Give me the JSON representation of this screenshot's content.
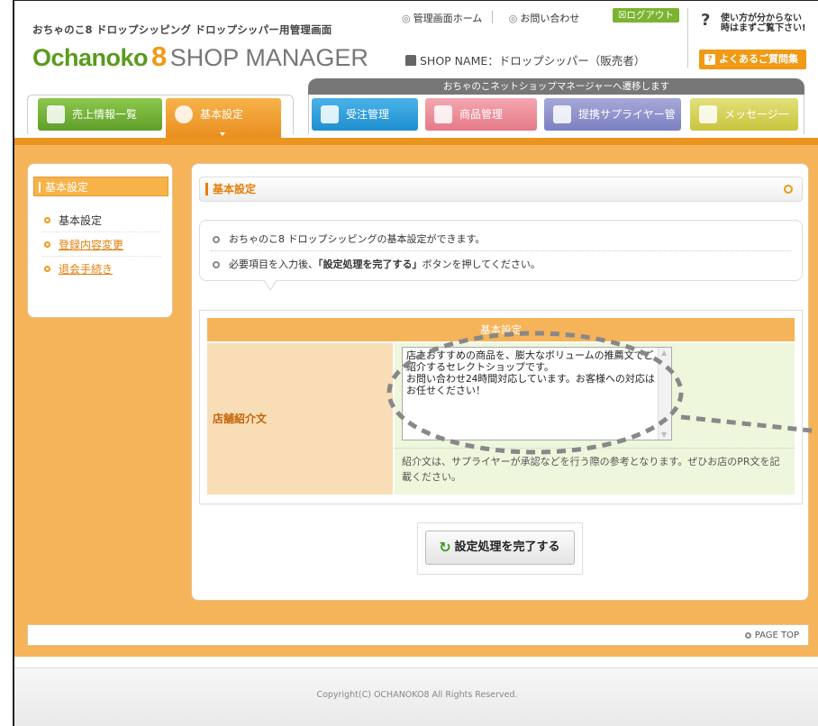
{
  "header": {
    "sub_title": "おちゃのこ8 ドロップシッピング ドロップシッパー用管理画面",
    "logo_main": "Ochanoko",
    "logo_eight": "8",
    "logo_sub": "SHOP MANAGER",
    "link_home": "管理画面ホーム",
    "link_contact": "お問い合わせ",
    "logout": "ログアウト",
    "shop_name": "SHOP NAME：ドロップシッパー（販売者）",
    "help_line1": "使い方が分からない",
    "help_line2": "時はまずご覧下さい!",
    "faq": "よくあるご質問集",
    "network_bar": "おちゃのこネットショップマネージャーへ遷移します"
  },
  "tabs": {
    "sales": "売上情報一覧",
    "basic": "基本設定",
    "orders": "受注管理",
    "products": "商品管理",
    "suppliers": "提携サプライヤー管理",
    "messages": "メッセージ一覧"
  },
  "sidebar": {
    "title": "基本設定",
    "items": [
      {
        "label": "基本設定"
      },
      {
        "label": "登録内容変更"
      },
      {
        "label": "退会手続き"
      }
    ]
  },
  "main": {
    "title": "基本設定",
    "info1": "おちゃのこ8 ドロップシッピングの基本設定ができます。",
    "info2_pre": "必要項目を入力後、",
    "info2_bold": "「設定処理を完了する」",
    "info2_post": "ボタンを押してください。",
    "form_head": "基本設定",
    "field_label": "店舗紹介文",
    "field_value": "店主おすすめの商品を、膨大なボリュームの推薦文でご紹介するセレクトショップです。\nお問い合わせ24時間対応しています。お客様への対応はお任せください！",
    "note": "紹介文は、サプライヤーが承認などを行う際の参考となります。ぜひお店のPR文を記載ください。",
    "submit": "設定処理を完了する"
  },
  "page_top": "PAGE TOP",
  "footer": "Copyright(C) OCHANOKO8 All Rights Reserved."
}
